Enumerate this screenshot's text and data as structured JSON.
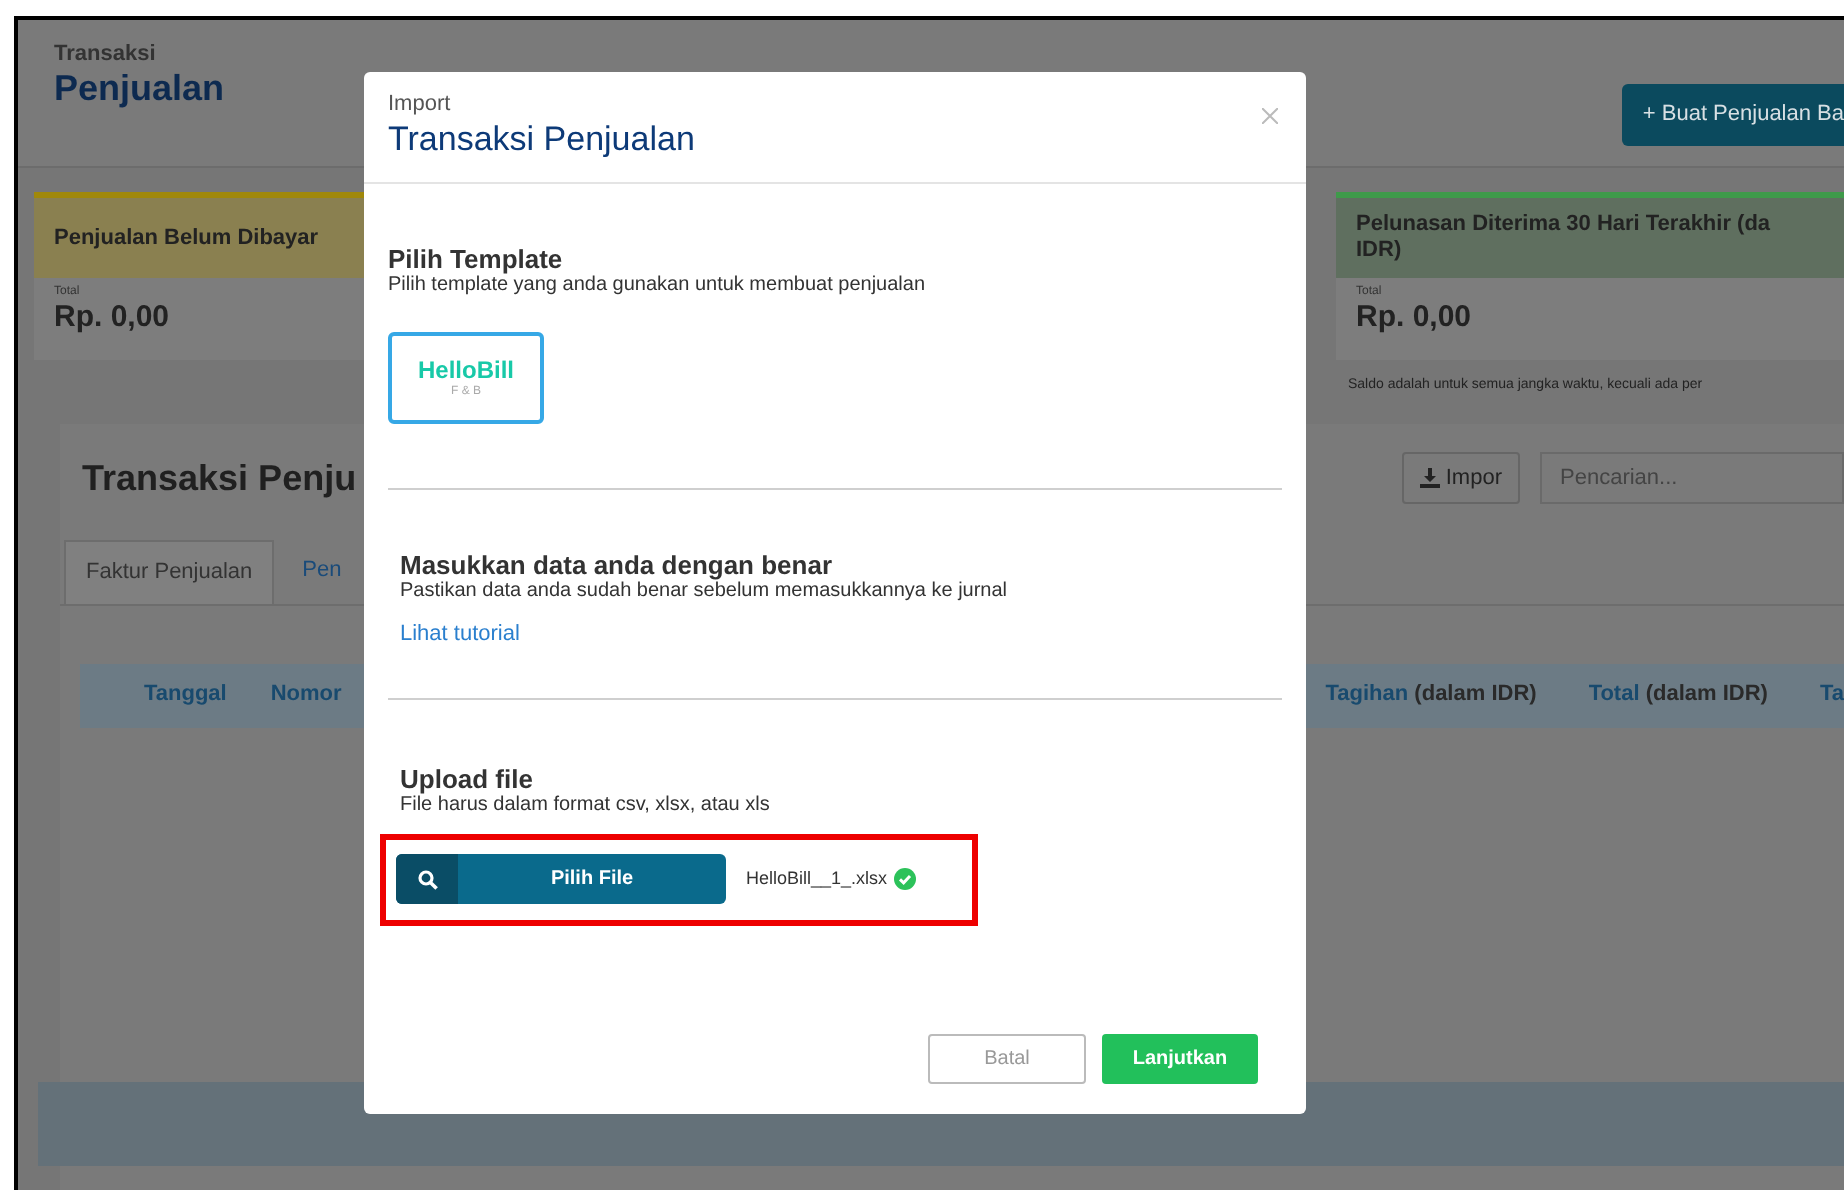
{
  "page": {
    "eyebrow": "Transaksi",
    "title": "Penjualan",
    "new_button": "+ Buat Penjualan Ba"
  },
  "cards": [
    {
      "kind": "unpaid",
      "title": "Penjualan Belum Dibayar",
      "total_label": "Total",
      "amount": "Rp. 0,00"
    },
    {
      "kind": "received",
      "title": "Pelunasan Diterima 30 Hari Terakhir (da IDR)",
      "total_label": "Total",
      "amount": "Rp. 0,00"
    }
  ],
  "note": "Saldo adalah untuk semua jangka waktu, kecuali ada per",
  "list": {
    "title": "Transaksi Penju",
    "import_button": "Impor",
    "search": {
      "placeholder": "Pencarian..."
    },
    "tabs": [
      {
        "label": "Faktur Penjualan",
        "selected": true
      },
      {
        "label": "Pen",
        "selected": false
      }
    ],
    "columns_left": [
      {
        "label": "Tanggal"
      },
      {
        "label": "Nomor"
      }
    ],
    "columns_right": [
      {
        "label": "Tagihan",
        "unit": "(dalam IDR)"
      },
      {
        "label": "Total",
        "unit": "(dalam IDR)"
      },
      {
        "label": "Ta"
      }
    ]
  },
  "modal": {
    "eyebrow": "Import",
    "title": "Transaksi Penjualan",
    "template": {
      "heading": "Pilih Template",
      "hint": "Pilih template yang anda gunakan untuk membuat penjualan",
      "option_name": "HelloBill",
      "option_sub": "F & B",
      "selected": true
    },
    "data": {
      "heading": "Masukkan data anda dengan benar",
      "hint": "Pastikan data anda sudah benar sebelum memasukkannya ke jurnal",
      "link": "Lihat tutorial"
    },
    "upload": {
      "heading": "Upload file",
      "hint": "File harus dalam format csv, xlsx, atau xls",
      "button": "Pilih File",
      "file_name": "HelloBill__1_.xlsx",
      "valid": true,
      "highlighted": true
    },
    "buttons": [
      {
        "label": "Batal",
        "kind": "secondary"
      },
      {
        "label": "Lanjutkan",
        "kind": "primary"
      }
    ]
  }
}
